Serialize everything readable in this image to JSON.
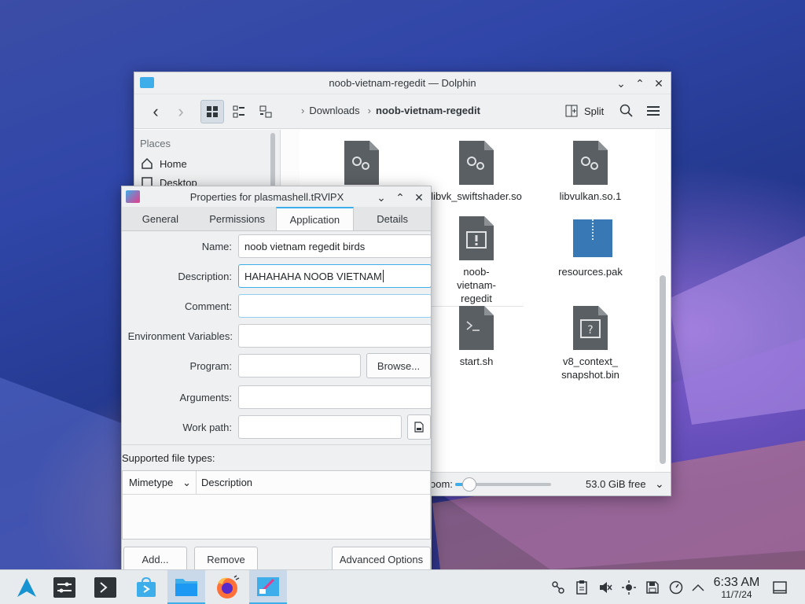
{
  "dolphin": {
    "title": "noob-vietnam-regedit — Dolphin",
    "toolbar": {
      "split_label": "Split"
    },
    "breadcrumb": [
      "Downloads",
      "noob-vietnam-regedit"
    ],
    "sidebar": {
      "heading": "Places",
      "items": [
        "Home",
        "Desktop"
      ]
    },
    "files": [
      {
        "name": "libvk_swiftshader.so",
        "icon": "gear-file-icon"
      },
      {
        "name": "libvulkan.so.1",
        "icon": "gear-file-icon"
      },
      {
        "name": "noob-vietnam-regedit",
        "icon": "executable-icon"
      },
      {
        "name": "resources.pak",
        "icon": "archive-icon"
      },
      {
        "name": "start.sh",
        "icon": "script-icon"
      },
      {
        "name": "v8_context_ snapshot.bin",
        "icon": "unknown-file-icon"
      }
    ],
    "status": {
      "zoom_label": "oom:",
      "zoom_level": 0.15,
      "free_space": "53.0 GiB free"
    }
  },
  "props": {
    "title": "Properties for plasmashell.tRVlPX",
    "tabs": [
      "General",
      "Permissions",
      "Application",
      "Details"
    ],
    "active_tab": "Application",
    "fields": {
      "name_label": "Name:",
      "name_value": "noob vietnam regedit birds",
      "description_label": "Description:",
      "description_value": "HAHAHAHA NOOB VIETNAM",
      "comment_label": "Comment:",
      "comment_value": "",
      "env_label": "Environment Variables:",
      "env_value": "",
      "program_label": "Program:",
      "program_value": "",
      "browse_label": "Browse...",
      "arguments_label": "Arguments:",
      "arguments_value": "",
      "workpath_label": "Work path:",
      "workpath_value": ""
    },
    "supported_label": "Supported file types:",
    "table_headers": [
      "Mimetype",
      "Description"
    ],
    "buttons": {
      "add": "Add...",
      "remove": "Remove",
      "advanced": "Advanced Options"
    }
  },
  "taskbar": {
    "clock_time": "6:33 AM",
    "clock_date": "11/7/24"
  },
  "colors": {
    "accent": "#3daee9",
    "taskbar": "#e8ebee",
    "window": "#eff0f1"
  }
}
